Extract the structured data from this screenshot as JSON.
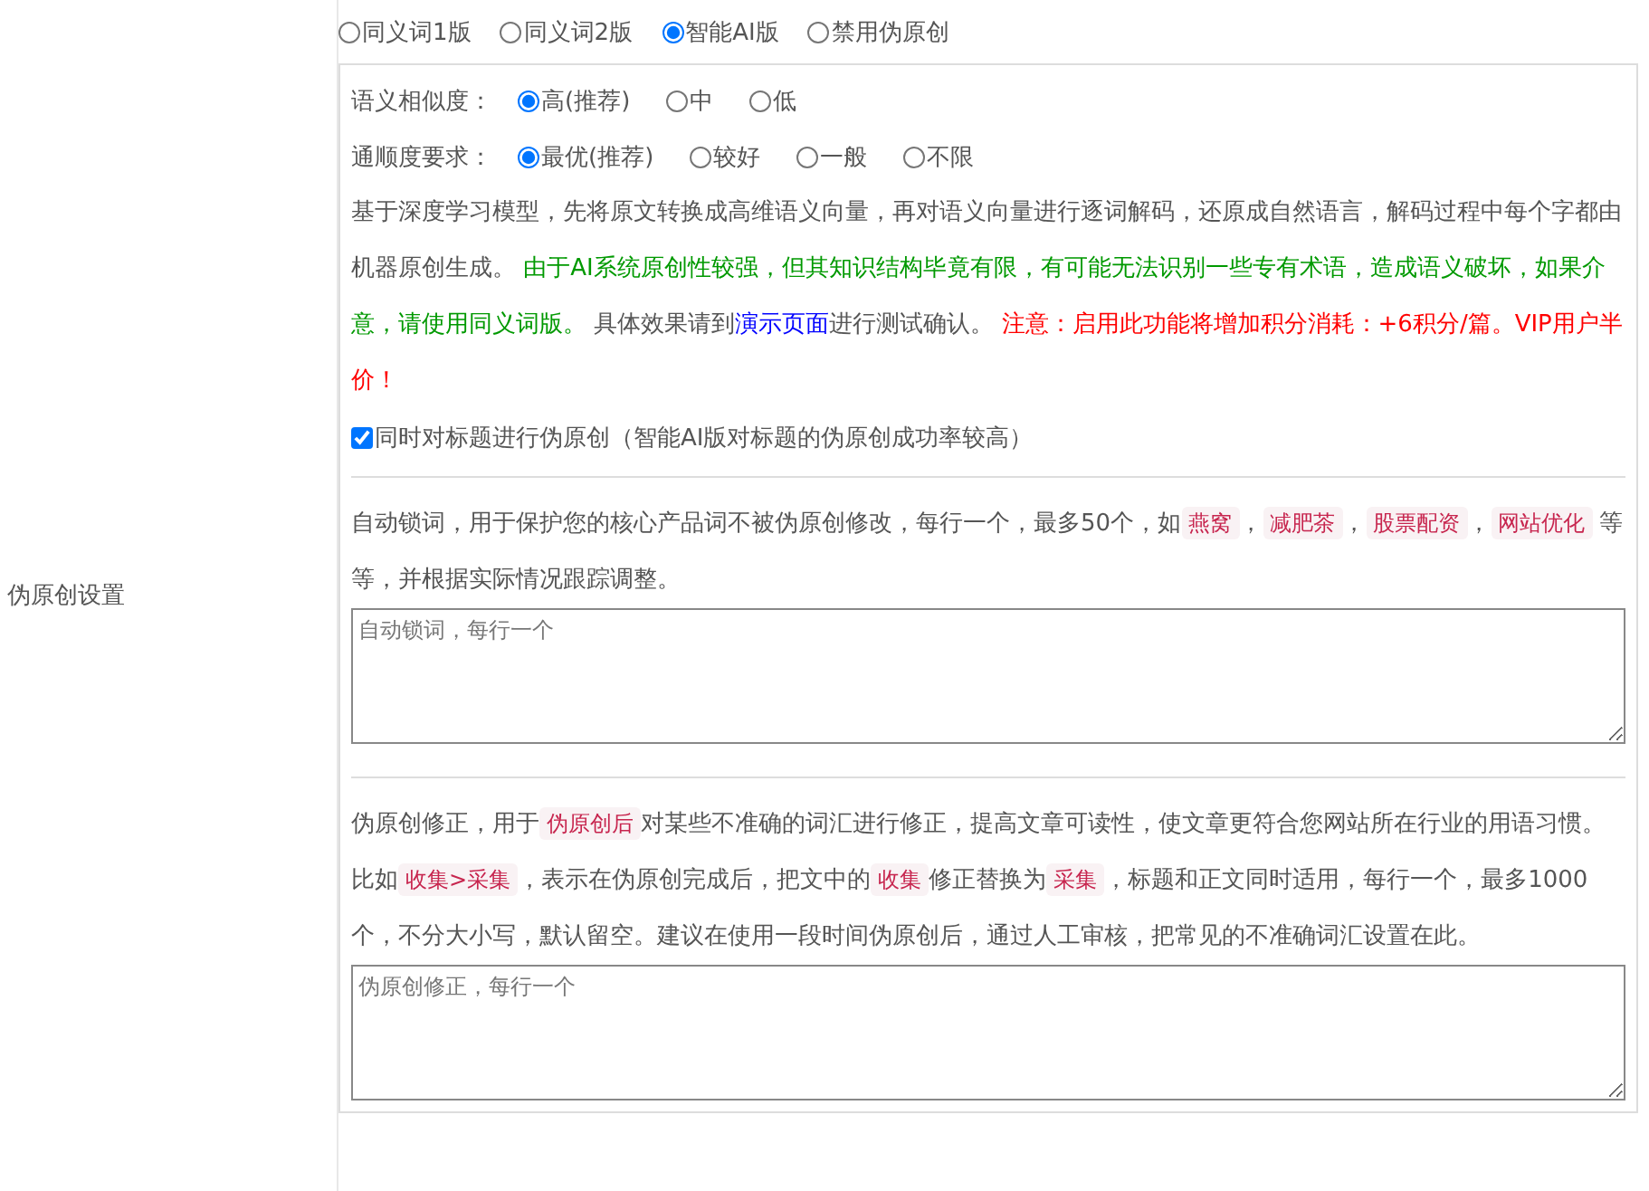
{
  "section_label": "伪原创设置",
  "modes": [
    {
      "label": "同义词1版",
      "selected": false
    },
    {
      "label": "同义词2版",
      "selected": false
    },
    {
      "label": "智能AI版",
      "selected": true
    },
    {
      "label": "禁用伪原创",
      "selected": false
    }
  ],
  "similarity": {
    "label": "语义相似度：",
    "options": [
      {
        "label": "高(推荐)",
        "selected": true
      },
      {
        "label": "中",
        "selected": false
      },
      {
        "label": "低",
        "selected": false
      }
    ]
  },
  "fluency": {
    "label": "通顺度要求：",
    "options": [
      {
        "label": "最优(推荐)",
        "selected": true
      },
      {
        "label": "较好",
        "selected": false
      },
      {
        "label": "一般",
        "selected": false
      },
      {
        "label": "不限",
        "selected": false
      }
    ]
  },
  "ai_description": [
    {
      "kind": "plain",
      "text": "基于深度学习模型，先将原文转换成高维语义向量，再对语义向量进行逐词解码，还原成自然语言，解码过程中每个字都由机器原创生成。 "
    },
    {
      "kind": "green",
      "text": "由于AI系统原创性较强，但其知识结构毕竟有限，有可能无法识别一些专有术语，造成语义破坏，如果介意，请使用同义词版。"
    },
    {
      "kind": "plain",
      "text": " 具体效果请到"
    },
    {
      "kind": "link",
      "text": "演示页面"
    },
    {
      "kind": "plain",
      "text": "进行测试确认。 "
    },
    {
      "kind": "red",
      "text": "注意：启用此功能将增加积分消耗：+6积分/篇。VIP用户半价！"
    }
  ],
  "title_option": {
    "label": "同时对标题进行伪原创（智能AI版对标题的伪原创成功率较高）",
    "checked": true
  },
  "lock_words": {
    "description": [
      {
        "kind": "plain",
        "text": "自动锁词，用于保护您的核心产品词不被伪原创修改，每行一个，最多50个，如"
      },
      {
        "kind": "code",
        "text": "燕窝"
      },
      {
        "kind": "plain",
        "text": "，"
      },
      {
        "kind": "code",
        "text": "减肥茶"
      },
      {
        "kind": "plain",
        "text": "，"
      },
      {
        "kind": "code",
        "text": "股票配资"
      },
      {
        "kind": "plain",
        "text": "，"
      },
      {
        "kind": "code",
        "text": "网站优化"
      },
      {
        "kind": "plain",
        "text": " 等等，并根据实际情况跟踪调整。"
      }
    ],
    "placeholder": "自动锁词，每行一个"
  },
  "correction": {
    "description": [
      {
        "kind": "plain",
        "text": "伪原创修正，用于"
      },
      {
        "kind": "code",
        "text": "伪原创后"
      },
      {
        "kind": "plain",
        "text": "对某些不准确的词汇进行修正，提高文章可读性，使文章更符合您网站所在行业的用语习惯。比如"
      },
      {
        "kind": "code",
        "text": "收集>采集"
      },
      {
        "kind": "plain",
        "text": "，表示在伪原创完成后，把文中的"
      },
      {
        "kind": "code",
        "text": "收集"
      },
      {
        "kind": "plain",
        "text": "修正替换为"
      },
      {
        "kind": "code",
        "text": "采集"
      },
      {
        "kind": "plain",
        "text": "，标题和正文同时适用，每行一个，最多1000个，不分大小写，默认留空。建议在使用一段时间伪原创后，通过人工审核，把常见的不准确词汇设置在此。"
      }
    ],
    "placeholder": "伪原创修正，每行一个"
  }
}
